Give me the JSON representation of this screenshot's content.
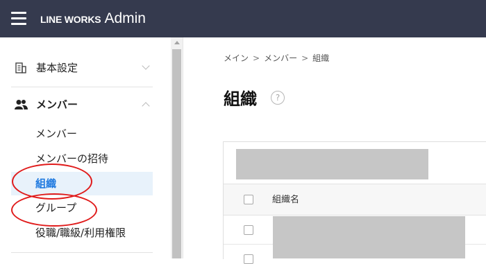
{
  "header": {
    "brand_logo": "LINE WORKS",
    "brand_suffix": "Admin",
    "background": "#353a4e"
  },
  "sidebar": {
    "basic_settings": {
      "label": "基本設定",
      "icon": "building-icon",
      "expanded": false
    },
    "members_section": {
      "label": "メンバー",
      "icon": "people-icon",
      "expanded": true,
      "items": [
        {
          "label": "メンバー",
          "active": false
        },
        {
          "label": "メンバーの招待",
          "active": false
        },
        {
          "label": "組織",
          "active": true
        },
        {
          "label": "グループ",
          "active": false
        },
        {
          "label": "役職/職級/利用権限",
          "active": false
        }
      ]
    },
    "active_color": "#1f7ae0",
    "active_background": "#e8f2fb"
  },
  "breadcrumb": [
    "メイン",
    "メンバー",
    "組織"
  ],
  "breadcrumb_separator": ">",
  "main": {
    "title": "組織",
    "help_icon": "?",
    "table": {
      "column_header": "組織名"
    }
  },
  "annotation_color": "#e01b1b"
}
